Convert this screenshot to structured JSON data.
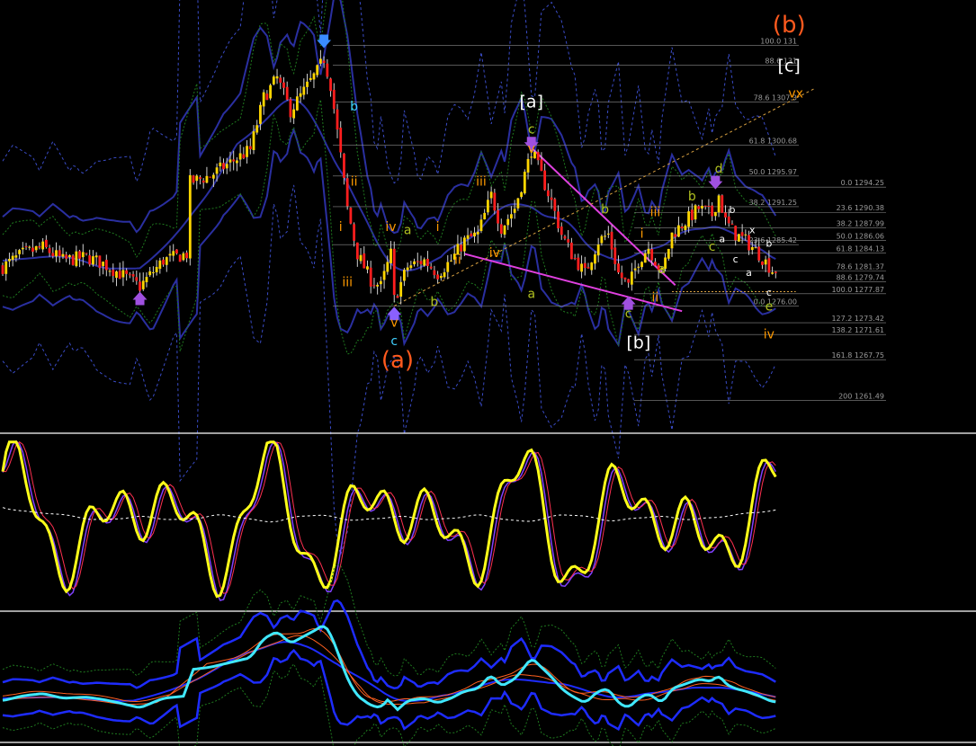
{
  "colors": {
    "background": "#000000",
    "separator": "#ffffff",
    "bull_body": "#ffd600",
    "bear_body": "#ff1e1e",
    "wick": "#d0d0d0",
    "band_navy": "#2a2fa0",
    "band_dashed_blue": "#3a4cc8",
    "band_green_dashed": "#1f7a1f",
    "trendline_magenta": "#e040e0",
    "trendline_orange_dashed": "#d8a040",
    "fib_line": "#8a8a8a",
    "fib_text": "#9a9a9a",
    "osc_yellow": "#ffff1a",
    "osc_purple": "#8040ff",
    "osc_red": "#ff3050",
    "osc_signal_white": "#ffffff",
    "ind_cyan": "#40e8ff",
    "ind_blue": "#1e2cff",
    "ind_orange": "#ff6020"
  },
  "chart_data": [
    {
      "type": "candlestick",
      "panel": "price",
      "title": "",
      "grid": false,
      "y_axis_visible": false,
      "fib_left": [
        {
          "pct": "100.0",
          "price": 1316,
          "label": "100.0 131"
        },
        {
          "pct": "88.6",
          "price": 1313,
          "label": "88.6 131"
        },
        {
          "pct": "78.6",
          "price": 1307.3,
          "label": "78.6 1307.3"
        },
        {
          "pct": "61.8",
          "price": 1300.68,
          "label": "61.8 1300.68"
        },
        {
          "pct": "50.0",
          "price": 1295.97,
          "label": "50.0 1295.97"
        },
        {
          "pct": "38.2",
          "price": 1291.25,
          "label": "38.2 1291.25"
        },
        {
          "pct": "23.6",
          "price": 1285.42,
          "label": "23.6 1285.42"
        },
        {
          "pct": "0.0",
          "price": 1276.0,
          "label": "0.0 1276.00"
        }
      ],
      "fib_right": [
        {
          "pct": "0.0",
          "price": 1294.25,
          "label": "0.0 1294.25"
        },
        {
          "pct": "23.6",
          "price": 1290.38,
          "label": "23.6 1290.38"
        },
        {
          "pct": "38.2",
          "price": 1287.99,
          "label": "38.2 1287.99"
        },
        {
          "pct": "50.0",
          "price": 1286.06,
          "label": "50.0 1286.06"
        },
        {
          "pct": "61.8",
          "price": 1284.13,
          "label": "61.8 1284.13"
        },
        {
          "pct": "78.6",
          "price": 1281.37,
          "label": "78.6 1281.37"
        },
        {
          "pct": "88.6",
          "price": 1279.74,
          "label": "88.6 1279.74"
        },
        {
          "pct": "100.0",
          "price": 1277.87,
          "label": "100.0 1277.87"
        },
        {
          "pct": "127.2",
          "price": 1273.42,
          "label": "127.2 1273.42"
        },
        {
          "pct": "138.2",
          "price": 1271.61,
          "label": "138.2 1271.61"
        },
        {
          "pct": "161.8",
          "price": 1267.75,
          "label": "161.8 1267.75"
        },
        {
          "pct": "200",
          "price": 1261.49,
          "label": "200 1261.49"
        }
      ],
      "wave_labels": [
        {
          "text": "(b)",
          "color": "#ff5a1e",
          "size": "big",
          "bar": 235,
          "price": 1318
        },
        {
          "text": "(a)",
          "color": "#ff5a1e",
          "size": "big",
          "bar": 118,
          "price": 1266.5
        },
        {
          "text": "[c]",
          "color": "#ffffff",
          "size": "mid",
          "bar": 235,
          "price": 1312
        },
        {
          "text": "[a]",
          "color": "#ffffff",
          "size": "mid",
          "bar": 158,
          "price": 1306.5
        },
        {
          "text": "[b]",
          "color": "#ffffff",
          "size": "mid",
          "bar": 190,
          "price": 1269.5
        },
        {
          "text": "vx",
          "color": "#ff9a00",
          "size": "small",
          "bar": 237,
          "price": 1308
        },
        {
          "text": "b",
          "color": "#40d0ff",
          "size": "small",
          "bar": 105,
          "price": 1306
        },
        {
          "text": "c",
          "color": "#b0c020",
          "size": "small",
          "bar": 158,
          "price": 1302.5
        },
        {
          "text": "v",
          "color": "#ff9a00",
          "size": "small",
          "bar": 158,
          "price": 1299.5
        },
        {
          "text": "iii",
          "color": "#ff9a00",
          "size": "small",
          "bar": 143,
          "price": 1294.5
        },
        {
          "text": "ii",
          "color": "#ff9a00",
          "size": "small",
          "bar": 105,
          "price": 1294.5
        },
        {
          "text": "i",
          "color": "#ff9a00",
          "size": "small",
          "bar": 101,
          "price": 1287.5
        },
        {
          "text": "iii",
          "color": "#ff9a00",
          "size": "small",
          "bar": 103,
          "price": 1279
        },
        {
          "text": "iv",
          "color": "#ff9a00",
          "size": "small",
          "bar": 116,
          "price": 1287.5
        },
        {
          "text": "a",
          "color": "#b0c020",
          "size": "small",
          "bar": 121,
          "price": 1287
        },
        {
          "text": "i",
          "color": "#ff9a00",
          "size": "small",
          "bar": 130,
          "price": 1287.5
        },
        {
          "text": "ii",
          "color": "#ff9a00",
          "size": "small",
          "bar": 136,
          "price": 1282.5
        },
        {
          "text": "iv",
          "color": "#ff9a00",
          "size": "small",
          "bar": 147,
          "price": 1283.5
        },
        {
          "text": "b",
          "color": "#b0c020",
          "size": "small",
          "bar": 129,
          "price": 1276
        },
        {
          "text": "v",
          "color": "#ff9a00",
          "size": "small",
          "bar": 117,
          "price": 1272.8
        },
        {
          "text": "c",
          "color": "#40d0ff",
          "size": "small",
          "bar": 117,
          "price": 1270
        },
        {
          "text": "a",
          "color": "#b0c020",
          "size": "small",
          "bar": 158,
          "price": 1277.2
        },
        {
          "text": "b",
          "color": "#b0c020",
          "size": "small",
          "bar": 180,
          "price": 1290.2
        },
        {
          "text": "c",
          "color": "#b0c020",
          "size": "small",
          "bar": 187,
          "price": 1274.2
        },
        {
          "text": "i",
          "color": "#ff9a00",
          "size": "small",
          "bar": 191,
          "price": 1286.5
        },
        {
          "text": "iii",
          "color": "#ff9a00",
          "size": "small",
          "bar": 195,
          "price": 1289.8
        },
        {
          "text": "a",
          "color": "#b0c020",
          "size": "small",
          "bar": 197,
          "price": 1281
        },
        {
          "text": "ii",
          "color": "#ff9a00",
          "size": "small",
          "bar": 195,
          "price": 1276.7
        },
        {
          "text": "b",
          "color": "#b0c020",
          "size": "small",
          "bar": 206,
          "price": 1292.2
        },
        {
          "text": "d",
          "color": "#b0c020",
          "size": "small",
          "bar": 214,
          "price": 1296.4
        },
        {
          "text": "c",
          "color": "#b0c020",
          "size": "small",
          "bar": 212,
          "price": 1284.5
        },
        {
          "text": "b",
          "color": "#ffffff",
          "size": "tiny",
          "bar": 218,
          "price": 1290.3
        },
        {
          "text": "a",
          "color": "#ffffff",
          "size": "tiny",
          "bar": 215,
          "price": 1285.8
        },
        {
          "text": "x",
          "color": "#ffffff",
          "size": "tiny",
          "bar": 224,
          "price": 1287.2
        },
        {
          "text": "c",
          "color": "#ffffff",
          "size": "tiny",
          "bar": 219,
          "price": 1282.7
        },
        {
          "text": "a",
          "color": "#ffffff",
          "size": "tiny",
          "bar": 223,
          "price": 1280.6
        },
        {
          "text": "b",
          "color": "#ffffff",
          "size": "tiny",
          "bar": 229,
          "price": 1285.1
        },
        {
          "text": "c",
          "color": "#ffffff",
          "size": "tiny",
          "bar": 229,
          "price": 1277.6
        },
        {
          "text": "e",
          "color": "#b0c020",
          "size": "small",
          "bar": 229,
          "price": 1275.3
        },
        {
          "text": "iv",
          "color": "#ff9a00",
          "size": "small",
          "bar": 229,
          "price": 1271
        }
      ],
      "arrows": [
        {
          "dir": "down",
          "color": "#3a8cff",
          "bar": 96,
          "price": 1316.3
        },
        {
          "dir": "up",
          "color": "#8a60ff",
          "bar": 117,
          "price": 1275.2
        },
        {
          "dir": "up",
          "color": "#a050e0",
          "bar": 41,
          "price": 1277.5
        },
        {
          "dir": "down",
          "color": "#a050e0",
          "bar": 158,
          "price": 1300.6
        },
        {
          "dir": "down",
          "color": "#a050e0",
          "bar": 213,
          "price": 1294.6
        },
        {
          "dir": "up",
          "color": "#a050e0",
          "bar": 187,
          "price": 1276.8
        }
      ]
    },
    {
      "type": "line",
      "panel": "oscillator",
      "title": "",
      "grid": false,
      "series": [
        {
          "color": "#ffff1a"
        },
        {
          "color": "#8040ff"
        },
        {
          "color": "#ff3050"
        },
        {
          "color": "#ffffff",
          "style": "dashed"
        }
      ]
    },
    {
      "type": "line",
      "panel": "bands",
      "title": "",
      "grid": false,
      "series": [
        {
          "color": "#40e8ff"
        },
        {
          "color": "#1e2cff"
        },
        {
          "color": "#ff6020"
        },
        {
          "color": "#1f7a1f",
          "style": "dashed"
        }
      ]
    }
  ]
}
